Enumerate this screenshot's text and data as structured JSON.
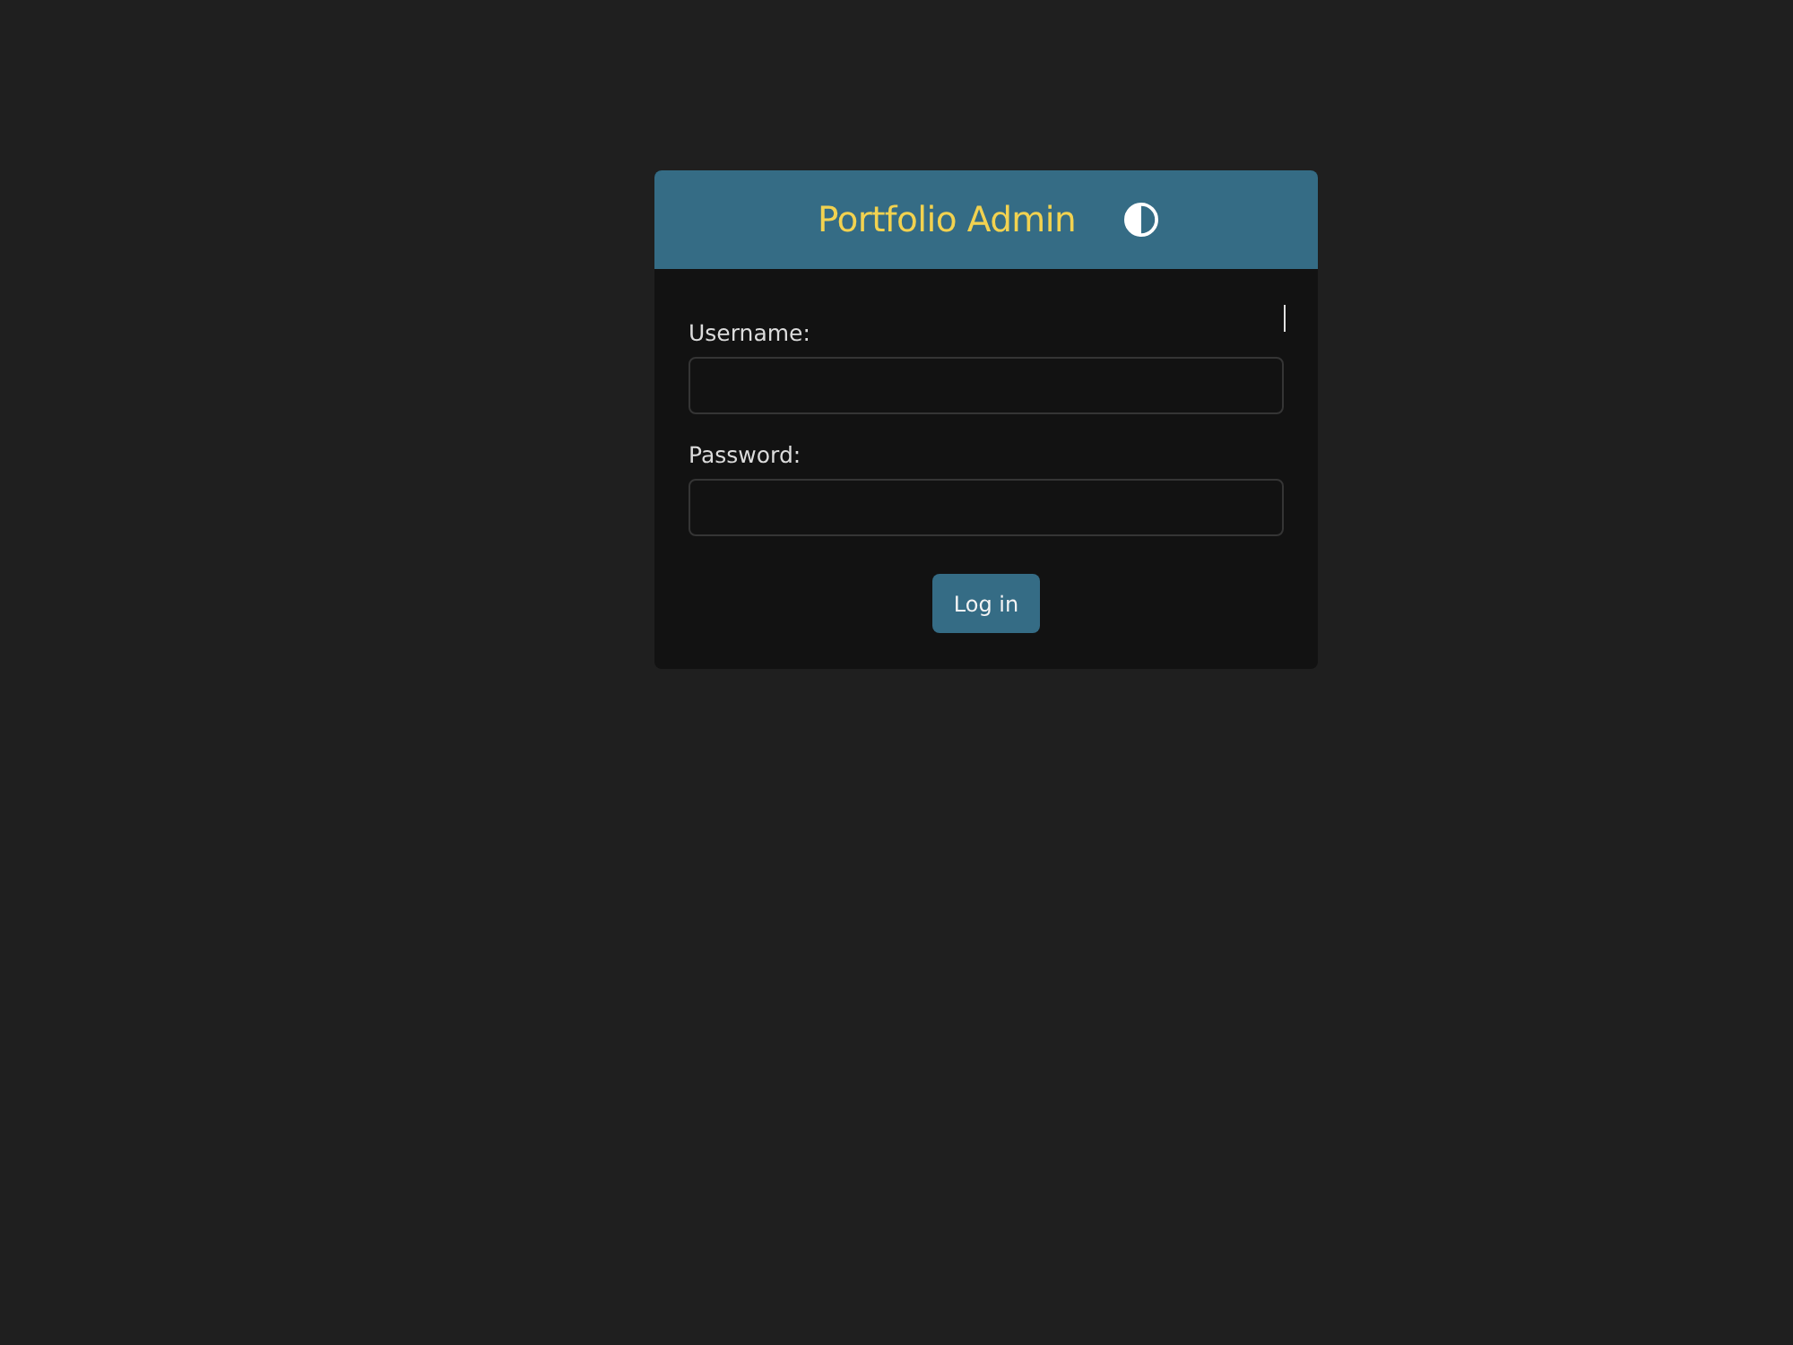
{
  "header": {
    "title": "Portfolio Admin"
  },
  "form": {
    "fields": [
      {
        "label": "Username:"
      },
      {
        "label": "Password:"
      }
    ],
    "submit": "Log in"
  }
}
